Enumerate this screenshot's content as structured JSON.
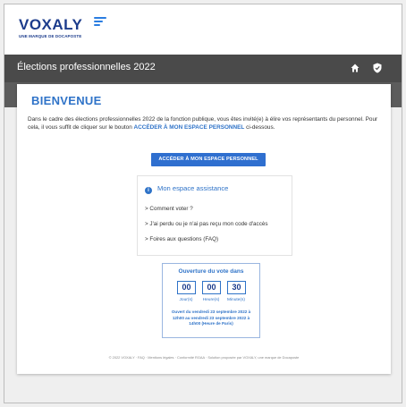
{
  "brand": {
    "name": "VOXALY",
    "tagline": "UNE MARQUE DE DOCAPOSTE"
  },
  "topbar": {
    "title": "Élections professionnelles 2022",
    "icons": [
      "home-icon",
      "shield-icon"
    ]
  },
  "main": {
    "welcome": "BIENVENUE",
    "intro_before": "Dans le cadre des élections professionnelles 2022 de la fonction publique, vous êtes invité(e) à élire vos représentants du personnel. Pour cela, il vous suffit de cliquer sur le bouton ",
    "intro_link": "ACCÉDER À MON ESPACE PERSONNEL",
    "intro_after": " ci-dessous.",
    "access_button": "ACCÉDER À MON ESPACE PERSONNEL"
  },
  "assistance": {
    "title": "Mon espace assistance",
    "links": [
      "> Comment voter ?",
      "> J'ai perdu ou je n'ai pas reçu mon code d'accès",
      "> Foires aux questions (FAQ)"
    ]
  },
  "countdown": {
    "title": "Ouverture du vote dans",
    "days": "00",
    "hours": "00",
    "minutes": "30",
    "days_label": "Jour(s)",
    "hours_label": "Heure(s)",
    "minutes_label": "Minute(s)",
    "note": "Ouvert du vendredi 23 septembre 2022 à 12h00 au vendredi 23 septembre 2022 à 14h00 (Heure de Paris)"
  },
  "footer": {
    "text": "© 2022 VOXALY · FAQ · Mentions légales · Conformité RGAA · Solution proposée par VOXALY, une marque de Docaposte"
  },
  "colors": {
    "accent": "#2f73c8",
    "brand": "#1c3c8c",
    "topbar": "#4a4a4a",
    "button": "#2f6fcf"
  }
}
